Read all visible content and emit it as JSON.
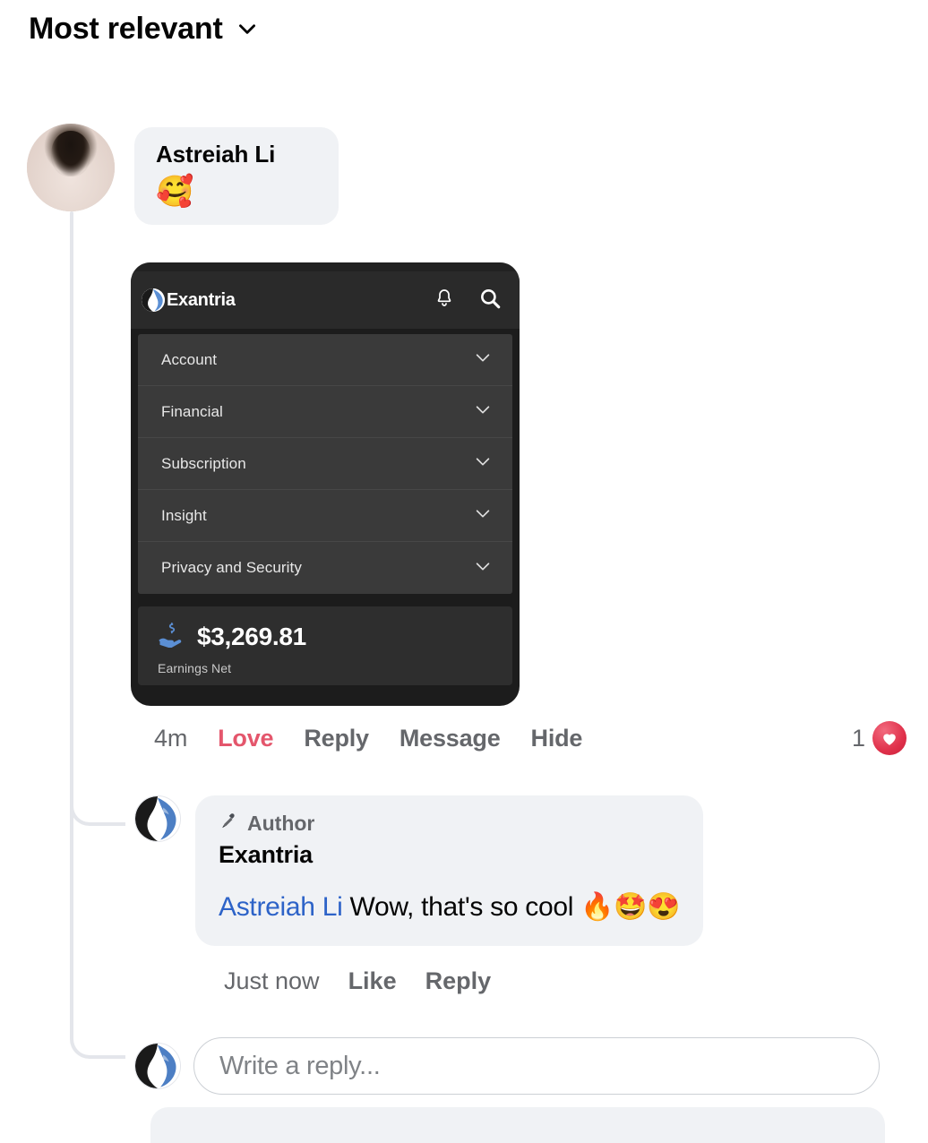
{
  "sort": {
    "label": "Most relevant",
    "chevron_icon": "chevron-down-icon"
  },
  "comment": {
    "author_name": "Astreiah Li",
    "body_emoji": "🥰",
    "avatar_icon": "user-photo-avatar",
    "attachment": {
      "brand": "Exantria",
      "logo_icon": "dragon-globe-logo-icon",
      "bell_icon": "bell-icon",
      "search_icon": "search-icon",
      "menu_items": [
        {
          "label": "Account",
          "chevron_icon": "chevron-down-icon"
        },
        {
          "label": "Financial",
          "chevron_icon": "chevron-down-icon"
        },
        {
          "label": "Subscription",
          "chevron_icon": "chevron-down-icon"
        },
        {
          "label": "Insight",
          "chevron_icon": "chevron-down-icon"
        },
        {
          "label": "Privacy and Security",
          "chevron_icon": "chevron-down-icon"
        }
      ],
      "earnings": {
        "icon": "hand-holding-dollar-icon",
        "amount": "$3,269.81",
        "label": "Earnings Net"
      }
    },
    "actions": {
      "timestamp": "4m",
      "reaction_label": "Love",
      "reply_label": "Reply",
      "message_label": "Message",
      "hide_label": "Hide",
      "reaction_count": "1",
      "reaction_icon": "heart-reaction-icon"
    }
  },
  "reply": {
    "avatar_icon": "dragon-globe-logo-icon",
    "author_badge_icon": "microphone-icon",
    "author_badge_label": "Author",
    "author_name": "Exantria",
    "mention": "Astreiah Li",
    "text": " Wow, that's so cool 🔥🤩😍",
    "meta": {
      "timestamp": "Just now",
      "like_label": "Like",
      "reply_label": "Reply"
    }
  },
  "composer": {
    "avatar_icon": "dragon-globe-logo-icon",
    "placeholder": "Write a reply..."
  },
  "colors": {
    "accent_love": "#e4566c",
    "mention_blue": "#2d63c8",
    "bubble_bg": "#f0f2f5",
    "dark_card": "#1c1c1c",
    "text_primary": "#050505",
    "text_secondary": "#65676b"
  }
}
